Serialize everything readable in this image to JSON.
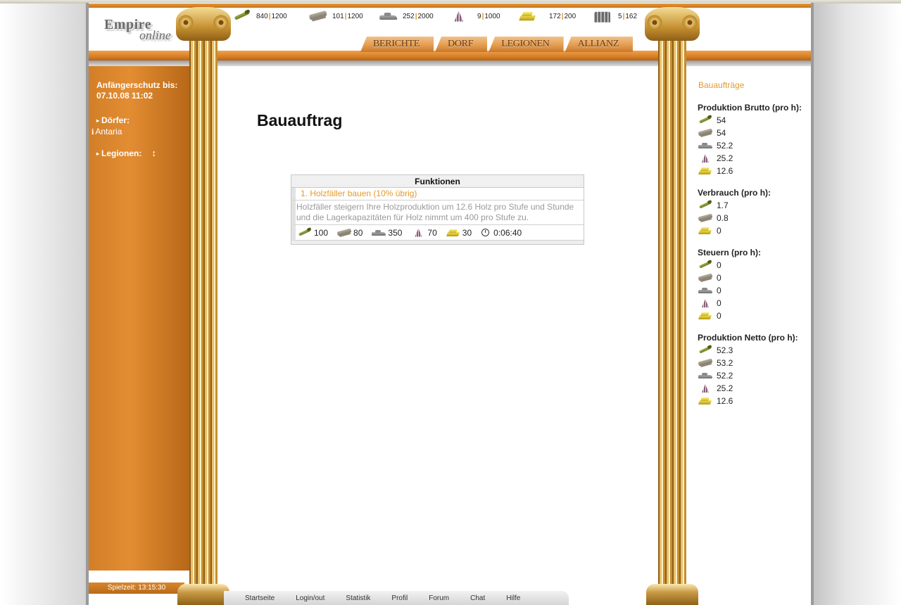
{
  "logo": {
    "line1": "Empire",
    "line2": "online"
  },
  "resources": [
    {
      "icon": "wood-icon",
      "current": "840",
      "max": "1200"
    },
    {
      "icon": "clay-icon",
      "current": "101",
      "max": "1200"
    },
    {
      "icon": "iron-icon",
      "current": "252",
      "max": "2000"
    },
    {
      "icon": "crop-icon",
      "current": "9",
      "max": "1000"
    },
    {
      "icon": "gold-icon",
      "current": "172",
      "max": "200"
    },
    {
      "icon": "population-icon",
      "current": "5",
      "max": "162"
    }
  ],
  "nav": {
    "berichte": "BERICHTE",
    "dorf": "DORF",
    "legionen": "LEGIONEN",
    "allianz": "ALLIANZ"
  },
  "sidebar": {
    "protection_label": "Anfängerschutz bis:",
    "protection_date": "07.10.08 11:02",
    "villages_label": "Dörfer:",
    "village_info": "i",
    "village_name": "Antaria",
    "legions_label": "Legionen:",
    "legions_arrows": "↕",
    "game_time": "Spielzeit: 13:15:30"
  },
  "main": {
    "title": "Bauauftrag",
    "table_header": "Funktionen",
    "task_link": "1. Holzfäller bauen (10% übrig)",
    "task_desc": "Holzfäller steigern Ihre Holzproduktion um 12.6 Holz pro Stufe und Stunde und die Lagerkapazitäten für Holz nimmt um 400 pro Stufe zu.",
    "costs": {
      "wood": "100",
      "clay": "80",
      "iron": "350",
      "crop": "70",
      "gold": "30",
      "time": "0:06:40"
    }
  },
  "right": {
    "link": "Bauaufträge",
    "brutto": {
      "title": "Produktion Brutto (pro h):",
      "wood": "54",
      "clay": "54",
      "iron": "52.2",
      "crop": "25.2",
      "gold": "12.6"
    },
    "verbrauch": {
      "title": "Verbrauch (pro h):",
      "wood": "1.7",
      "clay": "0.8",
      "gold": "0"
    },
    "steuern": {
      "title": "Steuern (pro h):",
      "wood": "0",
      "clay": "0",
      "iron": "0",
      "crop": "0",
      "gold": "0"
    },
    "netto": {
      "title": "Produktion Netto (pro h):",
      "wood": "52.3",
      "clay": "53.2",
      "iron": "52.2",
      "crop": "25.2",
      "gold": "12.6"
    }
  },
  "footer": {
    "startseite": "Startseite",
    "login": "Login/out",
    "statistik": "Statistik",
    "profil": "Profil",
    "forum": "Forum",
    "chat": "Chat",
    "hilfe": "Hilfe"
  }
}
